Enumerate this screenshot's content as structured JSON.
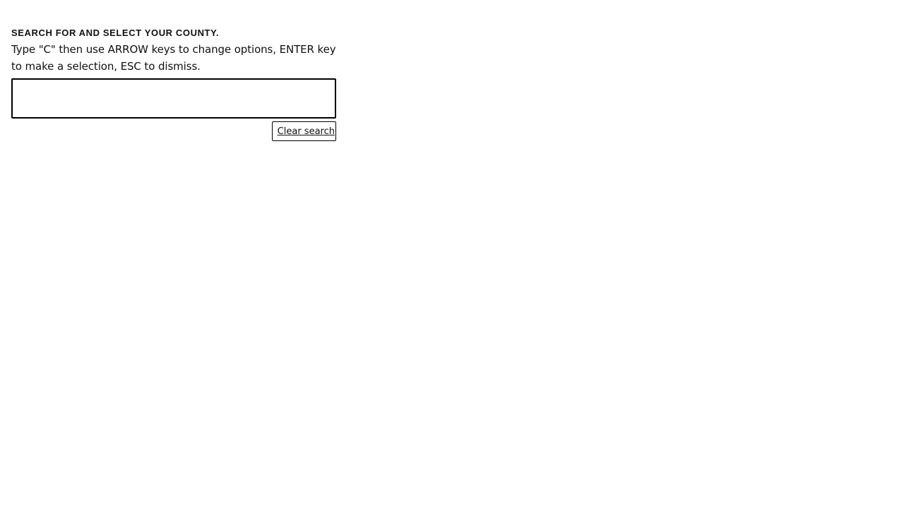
{
  "county_search": {
    "heading": "SEARCH FOR AND SELECT YOUR COUNTY.",
    "instructions": "Type \"C\" then use ARROW keys to change options, ENTER key to make a selection, ESC to dismiss.",
    "input_value": "",
    "clear_label": "Clear search"
  }
}
